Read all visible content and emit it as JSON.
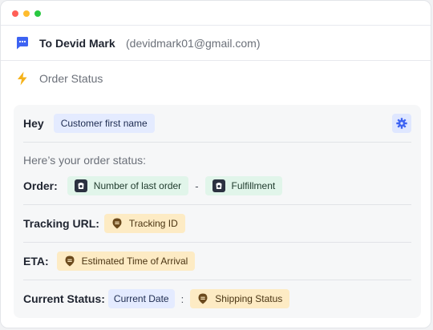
{
  "window": {
    "controls": [
      {
        "name": "close",
        "color": "#ff5f57"
      },
      {
        "name": "minimize",
        "color": "#febc2e"
      },
      {
        "name": "zoom",
        "color": "#28c840"
      }
    ]
  },
  "recipient": {
    "icon": "chat-bubble-icon",
    "label": "To Devid Mark",
    "email": "(devidmark01@gmail.com)"
  },
  "template": {
    "icon": "lightning-bolt-icon",
    "name": "Order Status"
  },
  "message": {
    "greeting": "Hey",
    "greeting_chip": "Customer first name",
    "settings_icon": "gear-icon",
    "intro": "Here’s your order status:",
    "order": {
      "label": "Order:",
      "chips": [
        {
          "text": "Number of last order",
          "icon": "shopify-icon"
        },
        {
          "text": "Fulfillment",
          "icon": "shopify-icon"
        }
      ],
      "joiner": "-"
    },
    "tracking": {
      "label": "Tracking URL:",
      "chip": {
        "text": "Tracking ID",
        "icon": "tracking-pin-icon"
      }
    },
    "eta": {
      "label": "ETA:",
      "chip": {
        "text": "Estimated Time of Arrival",
        "icon": "tracking-pin-icon"
      }
    },
    "current_status": {
      "label": "Current Status:",
      "date_chip": "Current Date",
      "joiner": ":",
      "chip": {
        "text": "Shipping Status",
        "icon": "tracking-pin-icon"
      }
    }
  },
  "colors": {
    "accent_blue": "#3d63f2",
    "chip_blue": "#e4ebff",
    "chip_green": "#e1f5ea",
    "chip_amber": "#fdebc4",
    "bolt": "#f5b21a"
  }
}
